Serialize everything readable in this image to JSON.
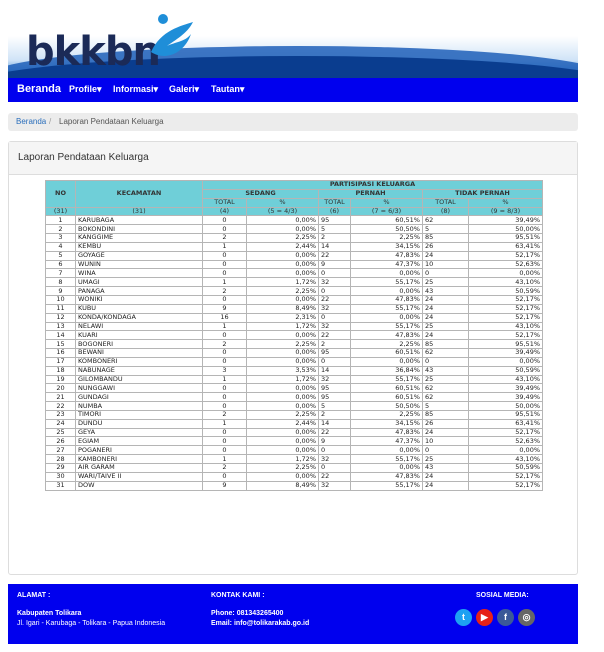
{
  "header": {
    "logo_text": "bkkbn"
  },
  "nav": {
    "brand": "Beranda",
    "items": [
      {
        "label": "Profile"
      },
      {
        "label": "Informasi"
      },
      {
        "label": "Galeri"
      },
      {
        "label": "Tautan"
      }
    ]
  },
  "breadcrumb": {
    "home": "Beranda",
    "separator": "/",
    "current": "Laporan Pendataan Keluarga"
  },
  "panel": {
    "title": "Laporan Pendataan Keluarga"
  },
  "table": {
    "headers": {
      "no": "NO",
      "kecamatan": "KECAMATAN",
      "partisipasi": "PARTISIPASI KELUARGA",
      "sedang": "SEDANG",
      "pernah": "PERNAH",
      "tidak_pernah": "TIDAK PERNAH",
      "total": "TOTAL",
      "percent": "%"
    },
    "index_row": [
      "(31)",
      "(31)",
      "(4)",
      "(5 = 4/3)",
      "(6)",
      "(7 = 6/3)",
      "(8)",
      "(9 = 8/3)"
    ],
    "rows": [
      [
        "1",
        "KARUBAGA",
        "0",
        "0,00%",
        "95",
        "60,51%",
        "62",
        "39,49%"
      ],
      [
        "2",
        "BOKONDINI",
        "0",
        "0,00%",
        "5",
        "50,50%",
        "5",
        "50,00%"
      ],
      [
        "3",
        "KANGGIME",
        "2",
        "2,25%",
        "2",
        "2,25%",
        "85",
        "95,51%"
      ],
      [
        "4",
        "KEMBU",
        "1",
        "2,44%",
        "14",
        "34,15%",
        "26",
        "63,41%"
      ],
      [
        "5",
        "GOYAGE",
        "0",
        "0,00%",
        "22",
        "47,83%",
        "24",
        "52,17%"
      ],
      [
        "6",
        "WUNIN",
        "0",
        "0,00%",
        "9",
        "47,37%",
        "10",
        "52,63%"
      ],
      [
        "7",
        "WINA",
        "0",
        "0,00%",
        "0",
        "0,00%",
        "0",
        "0,00%"
      ],
      [
        "8",
        "UMAGI",
        "1",
        "1,72%",
        "32",
        "55,17%",
        "25",
        "43,10%"
      ],
      [
        "9",
        "PANAGA",
        "2",
        "2,25%",
        "0",
        "0,00%",
        "43",
        "50,59%"
      ],
      [
        "10",
        "WONIKI",
        "0",
        "0,00%",
        "22",
        "47,83%",
        "24",
        "52,17%"
      ],
      [
        "11",
        "KUBU",
        "9",
        "8,49%",
        "32",
        "55,17%",
        "24",
        "52,17%"
      ],
      [
        "12",
        "KONDA/KONDAGA",
        "16",
        "2,31%",
        "0",
        "0,00%",
        "24",
        "52,17%"
      ],
      [
        "13",
        "NELAWI",
        "1",
        "1,72%",
        "32",
        "55,17%",
        "25",
        "43,10%"
      ],
      [
        "14",
        "KUARI",
        "0",
        "0,00%",
        "22",
        "47,83%",
        "24",
        "52,17%"
      ],
      [
        "15",
        "BOGONERI",
        "2",
        "2,25%",
        "2",
        "2,25%",
        "85",
        "95,51%"
      ],
      [
        "16",
        "BEWANI",
        "0",
        "0,00%",
        "95",
        "60,51%",
        "62",
        "39,49%"
      ],
      [
        "17",
        "KOMBONERI",
        "0",
        "0,00%",
        "0",
        "0,00%",
        "0",
        "0,00%"
      ],
      [
        "18",
        "NABUNAGE",
        "3",
        "3,53%",
        "14",
        "36,84%",
        "43",
        "50,59%"
      ],
      [
        "19",
        "GILOMBANDU",
        "1",
        "1,72%",
        "32",
        "55,17%",
        "25",
        "43,10%"
      ],
      [
        "20",
        "NUNGGAWI",
        "0",
        "0,00%",
        "95",
        "60,51%",
        "62",
        "39,49%"
      ],
      [
        "21",
        "GUNDAGI",
        "0",
        "0,00%",
        "95",
        "60,51%",
        "62",
        "39,49%"
      ],
      [
        "22",
        "NUMBA",
        "0",
        "0,00%",
        "5",
        "50,50%",
        "5",
        "50,00%"
      ],
      [
        "23",
        "TIMORI",
        "2",
        "2,25%",
        "2",
        "2,25%",
        "85",
        "95,51%"
      ],
      [
        "24",
        "DUNDU",
        "1",
        "2,44%",
        "14",
        "34,15%",
        "26",
        "63,41%"
      ],
      [
        "25",
        "GEYA",
        "0",
        "0,00%",
        "22",
        "47,83%",
        "24",
        "52,17%"
      ],
      [
        "26",
        "EGIAM",
        "0",
        "0,00%",
        "9",
        "47,37%",
        "10",
        "52,63%"
      ],
      [
        "27",
        "POGANERI",
        "0",
        "0,00%",
        "0",
        "0,00%",
        "0",
        "0,00%"
      ],
      [
        "28",
        "KAMBONERI",
        "1",
        "1,72%",
        "32",
        "55,17%",
        "25",
        "43,10%"
      ],
      [
        "29",
        "AIR GARAM",
        "2",
        "2,25%",
        "0",
        "0,00%",
        "43",
        "50,59%"
      ],
      [
        "30",
        "WARI/TAIVE II",
        "0",
        "0,00%",
        "22",
        "47,83%",
        "24",
        "52,17%"
      ],
      [
        "31",
        "DOW",
        "9",
        "8,49%",
        "32",
        "55,17%",
        "24",
        "52,17%"
      ]
    ]
  },
  "footer": {
    "alamat_title": "ALAMAT :",
    "alamat_name": "Kabupaten Tolikara",
    "alamat_line": "Jl. Igari - Karubaga - Tolikara - Papua Indonesia",
    "kontak_title": "KONTAK KAMI :",
    "phone_label": "Phone:",
    "phone": "081343265400",
    "email_label": "Email:",
    "email": "info@tolikarakab.go.id",
    "sosial_title": "SOSIAL MEDIA:",
    "social": [
      {
        "icon": "twitter-icon",
        "glyph": "t",
        "color": "#1da1f2"
      },
      {
        "icon": "youtube-icon",
        "glyph": "▶",
        "color": "#e62117"
      },
      {
        "icon": "facebook-icon",
        "glyph": "f",
        "color": "#3b5998"
      },
      {
        "icon": "instagram-icon",
        "glyph": "◎",
        "color": "#666666"
      }
    ]
  },
  "colors": {
    "navbar": "#0000ee",
    "table_header": "#6fcfd8",
    "link": "#2a6ebb"
  }
}
